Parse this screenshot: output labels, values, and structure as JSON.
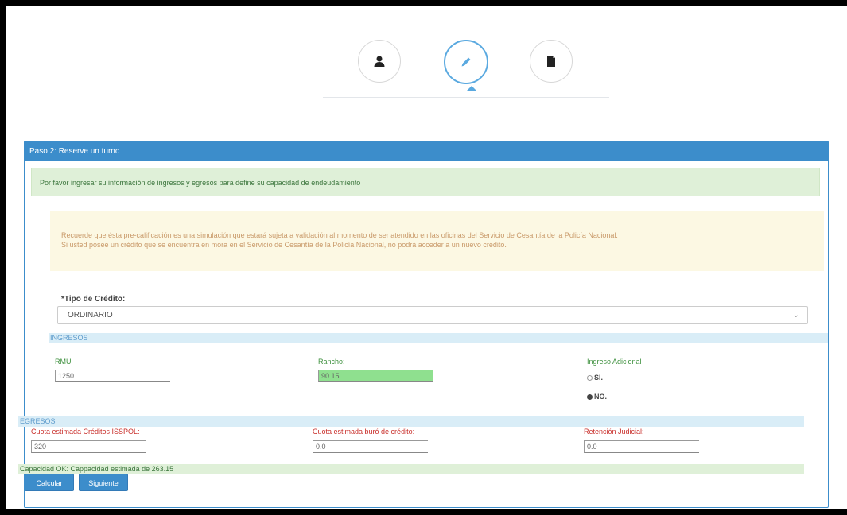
{
  "steps": [
    {
      "icon": "user-icon",
      "active": false
    },
    {
      "icon": "pencil-icon",
      "active": true
    },
    {
      "icon": "document-icon",
      "active": false
    }
  ],
  "panel": {
    "title": "Paso 2: Reserve un turno"
  },
  "info_message": "Por favor ingresar su información de ingresos y egresos para define su capacidad de endeudamiento",
  "warning": {
    "line1": "Recuerde que ésta pre-calificación es una simulación que estará sujeta a validación al momento de ser atendido en las oficinas del Servicio de Cesantía de la Policía Nacional.",
    "line2": "Si usted posee un crédito que se encuentra en mora en el Servicio de Cesantía de la Policía Nacional, no podrá acceder a un nuevo crédito."
  },
  "tipo_credito": {
    "label": "*Tipo de Crédito:",
    "value": "ORDINARIO"
  },
  "ingresos": {
    "title": "INGRESOS",
    "rmu_label": "RMU",
    "rmu_value": "1250",
    "rancho_label": "Rancho:",
    "rancho_value": "90.15",
    "adicional_label": "Ingreso Adicional",
    "opt_si": "SI.",
    "opt_no": "NO."
  },
  "egresos": {
    "title": "EGRESOS",
    "cuota_issfa_label": "Cuota estimada Créditos ISSPOL:",
    "cuota_issfa_value": "320",
    "cuota_buro_label": "Cuota estimada buró de crédito:",
    "cuota_buro_value": "0.0",
    "retencion_label": "Retención Judicial:",
    "retencion_value": "0.0"
  },
  "capacidad_text": "Capacidad OK: Cappacidad estimada de 263.15",
  "buttons": {
    "calcular": "Calcular",
    "siguiente": "Siguiente"
  },
  "colors": {
    "primary": "#3c8dcb",
    "success_bg": "#dff0d8",
    "warning_bg": "#fcf8e3",
    "info_bg": "#d9edf7",
    "highlight_input": "#8fe08f"
  }
}
